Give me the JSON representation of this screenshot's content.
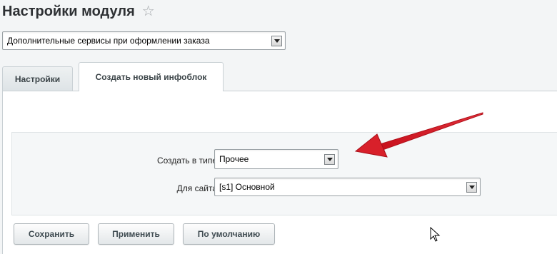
{
  "header": {
    "title": "Настройки модуля",
    "star_icon": "star-icon"
  },
  "module_select": {
    "value": "Дополнительные сервисы при оформлении заказа"
  },
  "tabs": [
    {
      "label": "Настройки",
      "active": false
    },
    {
      "label": "Создать новый инфоблок",
      "active": true
    }
  ],
  "form": {
    "type_label": "Создать в типе",
    "type_value": "Прочее",
    "site_label": "Для сайта",
    "site_value": "[s1] Основной"
  },
  "buttons": {
    "save": "Сохранить",
    "apply": "Применить",
    "default": "По умолчанию"
  },
  "colors": {
    "annotation_arrow": "#d8202a",
    "background": "#f3f5f6"
  },
  "icons": {
    "annotation": "red-arrow-icon",
    "cursor": "mouse-cursor-icon",
    "dropdown": "dropdown-arrow-icon"
  }
}
